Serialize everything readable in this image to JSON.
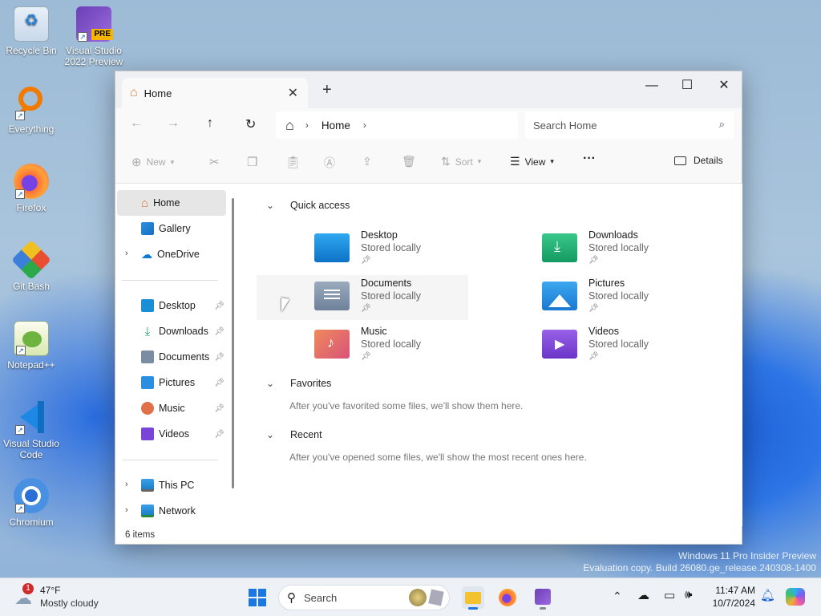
{
  "desktop": {
    "icons": [
      {
        "label": "Recycle Bin",
        "name": "recycle-bin-icon"
      },
      {
        "label": "Visual Studio 2022 Preview",
        "badge": "PRE",
        "name": "visual-studio-icon"
      },
      {
        "label": "Everything",
        "name": "everything-icon"
      },
      {
        "label": "Firefox",
        "name": "firefox-icon"
      },
      {
        "label": "Git Bash",
        "name": "git-bash-icon"
      },
      {
        "label": "Notepad++",
        "name": "notepadpp-icon"
      },
      {
        "label": "Visual Studio Code",
        "name": "vscode-icon"
      },
      {
        "label": "Chromium",
        "name": "chromium-icon"
      }
    ],
    "watermark": {
      "line1": "Windows 11 Pro Insider Preview",
      "line2": "Evaluation copy. Build 26080.ge_release.240308-1400"
    }
  },
  "explorer": {
    "tab_title": "Home",
    "address": {
      "crumb": "Home"
    },
    "search_placeholder": "Search Home",
    "commands": {
      "new": "New",
      "sort": "Sort",
      "view": "View",
      "details": "Details"
    },
    "sidebar": {
      "home": "Home",
      "gallery": "Gallery",
      "onedrive": "OneDrive",
      "pinned": [
        {
          "label": "Desktop",
          "color": "#1a8ed6"
        },
        {
          "label": "Downloads",
          "color": "#1e9e6a"
        },
        {
          "label": "Documents",
          "color": "#7c8da3"
        },
        {
          "label": "Pictures",
          "color": "#2a8fe0"
        },
        {
          "label": "Music",
          "color": "#e0704a"
        },
        {
          "label": "Videos",
          "color": "#7a44d8"
        }
      ],
      "this_pc": "This PC",
      "network": "Network"
    },
    "sections": {
      "quick_access": "Quick access",
      "favorites": "Favorites",
      "favorites_empty": "After you've favorited some files, we'll show them here.",
      "recent": "Recent",
      "recent_empty": "After you've opened some files, we'll show the most recent ones here."
    },
    "quick_access": [
      {
        "name": "Desktop",
        "sub": "Stored locally",
        "color": "#1a8ed6"
      },
      {
        "name": "Downloads",
        "sub": "Stored locally",
        "color": "#1e9e6a"
      },
      {
        "name": "Documents",
        "sub": "Stored locally",
        "color": "#7c8da3"
      },
      {
        "name": "Pictures",
        "sub": "Stored locally",
        "color": "#2a8fe0"
      },
      {
        "name": "Music",
        "sub": "Stored locally",
        "color": "#e0704a"
      },
      {
        "name": "Videos",
        "sub": "Stored locally",
        "color": "#7a44d8"
      }
    ],
    "status": "6 items"
  },
  "taskbar": {
    "weather": {
      "temp": "47°F",
      "desc": "Mostly cloudy",
      "badge": "1"
    },
    "search_label": "Search",
    "time": "11:47 AM",
    "date": "10/7/2024"
  }
}
